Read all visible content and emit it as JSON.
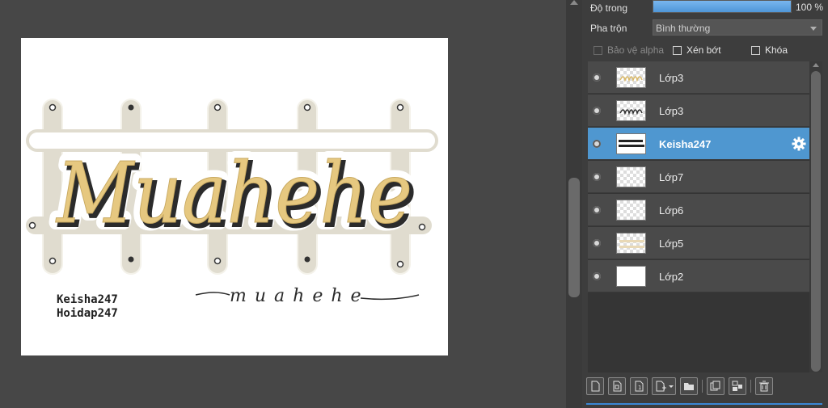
{
  "panel": {
    "opacity_label": "Độ trong",
    "opacity_value": "100 %",
    "opacity_fraction": 1.0,
    "blend_label": "Pha trộn",
    "blend_value": "Bình thường",
    "checkbox_protect_alpha": "Bảo vệ alpha",
    "checkbox_clipping": "Xén bớt",
    "checkbox_lock": "Khóa"
  },
  "layers": [
    {
      "name": "Lớp3",
      "active": false,
      "thumb": "checker-text"
    },
    {
      "name": "Lớp3",
      "active": false,
      "thumb": "checker-script"
    },
    {
      "name": "Keisha247",
      "active": true,
      "thumb": "text"
    },
    {
      "name": "Lớp7",
      "active": false,
      "thumb": "checker"
    },
    {
      "name": "Lớp6",
      "active": false,
      "thumb": "checker"
    },
    {
      "name": "Lớp5",
      "active": false,
      "thumb": "checker-light"
    },
    {
      "name": "Lớp2",
      "active": false,
      "thumb": "plain"
    }
  ],
  "canvas": {
    "main_text": "Muahehe",
    "credit_line1": "Keisha247",
    "credit_line2": "Hoidap247",
    "signature_text": "muahehe",
    "colors": {
      "fence": "#e0dccf",
      "text_fill": "#e6c880",
      "text_shadow": "#2b2b2b"
    }
  },
  "icons": [
    "new-layer-icon",
    "new-raster-layer-icon",
    "new-halftone-layer-icon",
    "add-layer-dropdown-icon",
    "folder-icon",
    "duplicate-icon",
    "merge-down-icon",
    "delete-icon"
  ]
}
